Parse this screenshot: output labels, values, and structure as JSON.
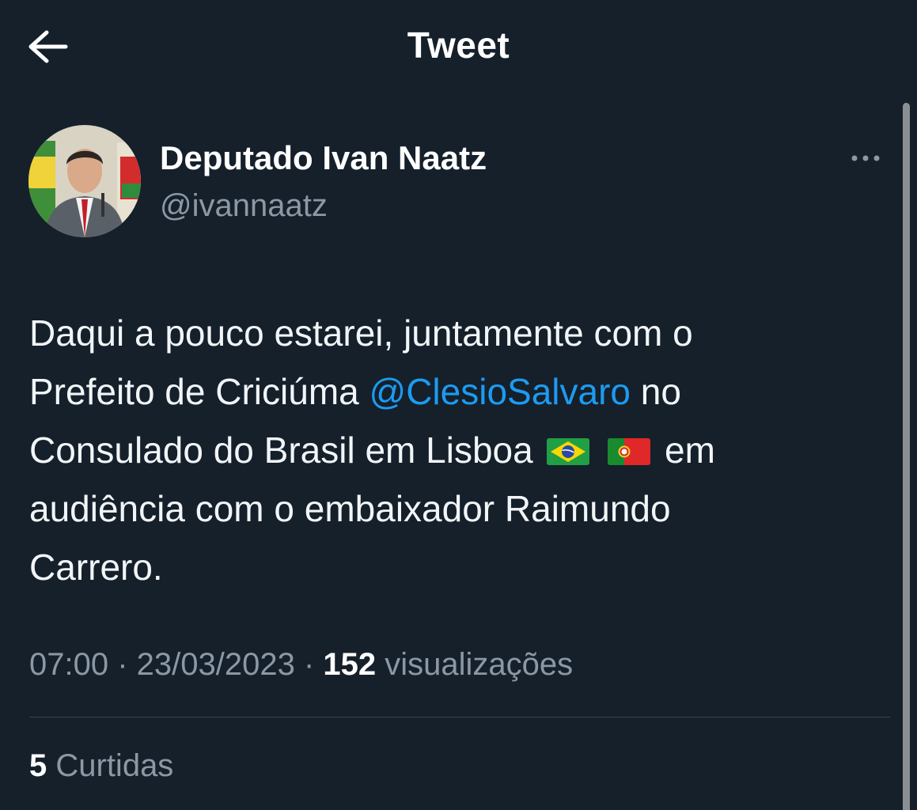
{
  "header": {
    "title": "Tweet",
    "back_icon": "arrow-left-icon"
  },
  "author": {
    "display_name": "Deputado Ivan Naatz",
    "handle": "@ivannaatz",
    "more_icon": "more-horizontal-icon"
  },
  "tweet": {
    "lines": [
      {
        "text": "Daqui a pouco estarei, juntamente com o"
      },
      {
        "before": "Prefeito de Criciúma ",
        "mention": "@ClesioSalvaro",
        "after": "  no"
      },
      {
        "before": "Consulado do Brasil em Lisboa",
        "after": " em",
        "flags": [
          "brazil-flag-icon",
          "portugal-flag-icon"
        ]
      },
      {
        "text": "audiência com o embaixador Raimundo"
      },
      {
        "text": "Carrero."
      }
    ]
  },
  "meta": {
    "time": "07:00",
    "separator": " · ",
    "date": "23/03/2023",
    "views_count": "152",
    "views_label": " visualizações"
  },
  "likes": {
    "count": "5",
    "label": " Curtidas"
  },
  "colors": {
    "background": "#15202b",
    "link": "#1d9bf0",
    "secondary_text": "#8b98a5",
    "divider": "#38444d"
  }
}
